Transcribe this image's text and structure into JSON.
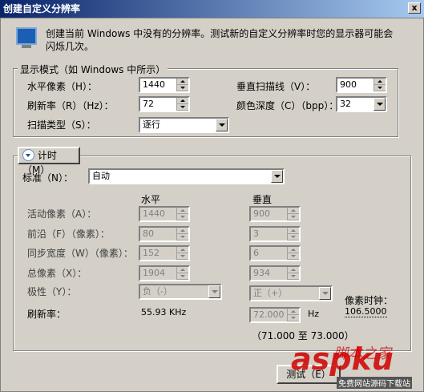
{
  "window": {
    "title": "创建自定义分辨率",
    "close": "x",
    "description": "创建当前 Windows 中没有的分辨率。测试新的自定义分辨率时您的显示器可能会闪烁几次。"
  },
  "display_mode": {
    "legend": "显示模式（如 Windows 中所示）",
    "h_pixels": {
      "label": "水平像素（H）：",
      "value": "1440"
    },
    "refresh": {
      "label": "刷新率（R）（Hz）：",
      "value": "72"
    },
    "scan_type": {
      "label": "扫描类型（S）：",
      "value": "逐行"
    },
    "v_lines": {
      "label": "垂直扫描线（V）：",
      "value": "900"
    },
    "color_depth": {
      "label": "颜色深度（C）（bpp）：",
      "value": "32"
    }
  },
  "timing": {
    "button_label": "计时（M）",
    "standard": {
      "label": "标准（N）：",
      "value": "自动"
    },
    "col_horizontal": "水平",
    "col_vertical": "垂直",
    "rows": [
      {
        "label": "活动像素（A）：",
        "h": "1440",
        "v": "900"
      },
      {
        "label": "前沿（F）（像素）：",
        "h": "80",
        "v": "3"
      },
      {
        "label": "同步宽度（W）（像素）：",
        "h": "152",
        "v": "6"
      },
      {
        "label": "总像素（X）：",
        "h": "1904",
        "v": "934"
      }
    ],
    "polarity": {
      "label": "极性（Y）：",
      "h": "负（-）",
      "v": "正（+）"
    },
    "refresh": {
      "label": "刷新率：",
      "h_value": "55.93 KHz",
      "v_value": "72.000",
      "v_unit": "Hz",
      "range": "（71.000 至 73.000）"
    },
    "pixel_clock": {
      "label": "像素时钟：",
      "value": "106.5000"
    }
  },
  "footer": {
    "test_button": "测试（E）",
    "watermark_main": "aspku",
    "watermark_sub": "免费网站源码下载站",
    "watermark_script": "脚本之家"
  }
}
